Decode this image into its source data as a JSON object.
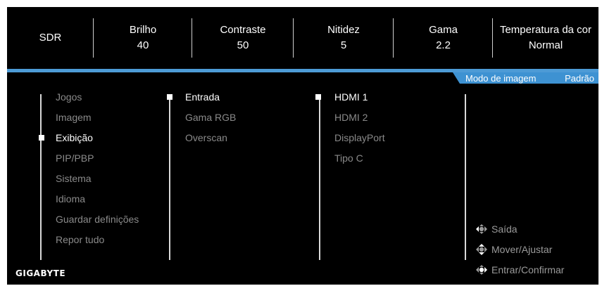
{
  "topbar": [
    {
      "label": "SDR",
      "value": ""
    },
    {
      "label": "Brilho",
      "value": "40"
    },
    {
      "label": "Contraste",
      "value": "50"
    },
    {
      "label": "Nitidez",
      "value": "5"
    },
    {
      "label": "Gama",
      "value": "2.2"
    },
    {
      "label": "Temperatura da cor",
      "value": "Normal"
    }
  ],
  "mode": {
    "label": "Modo de imagem",
    "value": "Padrão"
  },
  "menu": {
    "main": [
      "Jogos",
      "Imagem",
      "Exibição",
      "PIP/PBP",
      "Sistema",
      "Idioma",
      "Guardar definições",
      "Repor tudo"
    ],
    "sub": [
      "Entrada",
      "Gama RGB",
      "Overscan"
    ],
    "options": [
      "HDMI 1",
      "HDMI 2",
      "DisplayPort",
      "Tipo C"
    ]
  },
  "hints": {
    "exit": "Saída",
    "move": "Mover/Ajustar",
    "enter": "Entrar/Confirmar"
  },
  "brand": "GIGABYTE",
  "colors": {
    "accent": "#3e92d2",
    "background": "#000000",
    "selected_text": "#ffffff",
    "dim_text": "#8a8a8a"
  }
}
